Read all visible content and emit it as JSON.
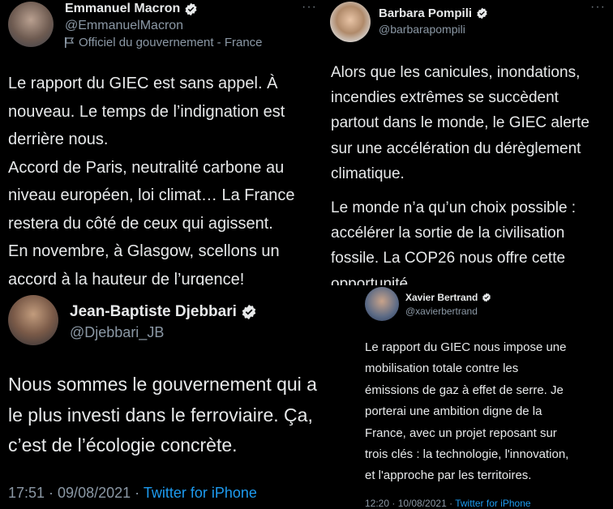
{
  "tweets": [
    {
      "author_name": "Emmanuel Macron",
      "handle": "@EmmanuelMacron",
      "label": "Officiel du gouvernement - France",
      "more": "···",
      "lines": [
        "Le rapport du GIEC est sans appel. À",
        "nouveau. Le temps de l’indignation est",
        "derrière nous.",
        "Accord de Paris, neutralité carbone au",
        "niveau européen, loi climat… La France",
        "restera du côté de ceux qui agissent.",
        "En novembre, à Glasgow, scellons un",
        "accord à la hauteur de l’urgence!"
      ]
    },
    {
      "author_name": "Barbara Pompili",
      "handle": "@barbarapompili",
      "more": "···",
      "lines": [
        "Alors que les canicules, inondations,",
        "incendies extrêmes se succèdent",
        "partout dans le monde, le GIEC alerte",
        "sur une accélération du dérèglement",
        "climatique."
      ],
      "lines2": [
        "Le monde n’a qu’un choix possible :",
        "accélérer la sortie de la civilisation",
        "fossile. La COP26 nous offre cette",
        "opportunité."
      ]
    },
    {
      "author_name": "Jean-Baptiste Djebbari",
      "handle": "@Djebbari_JB",
      "lines": [
        "Nous sommes le gouvernement qui a",
        "le plus investi dans le ferroviaire. Ça,",
        "c’est de l’écologie concrète."
      ],
      "time": "17:51 · 09/08/2021 · ",
      "source": "Twitter for iPhone"
    },
    {
      "author_name": "Xavier Bertrand",
      "handle": "@xavierbertrand",
      "lines": [
        "Le rapport du GIEC nous impose une",
        "mobilisation totale contre les",
        "émissions de gaz à effet de serre. Je",
        "porterai une ambition digne de la",
        "France, avec un projet reposant sur",
        "trois clés : la technologie, l'innovation,",
        "et l'approche par les territoires."
      ],
      "time": "12:20 · 10/08/2021 · ",
      "source": "Twitter for iPhone"
    }
  ],
  "colors": {
    "background": "#000000",
    "text": "#e7e9ea",
    "secondary": "#8b98a5",
    "link": "#1d9bf0",
    "verified": "#e7e9ea"
  },
  "icons": {
    "verified": "verified-badge-icon",
    "flag": "flag-icon",
    "more": "more-dots-icon"
  }
}
